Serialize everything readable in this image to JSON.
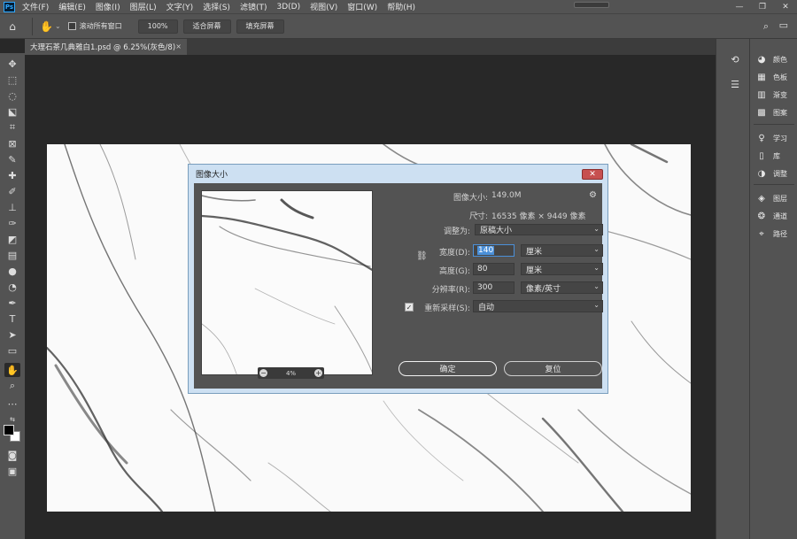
{
  "app": {
    "logo": "Ps",
    "menu": [
      "文件(F)",
      "编辑(E)",
      "图像(I)",
      "图层(L)",
      "文字(Y)",
      "选择(S)",
      "滤镜(T)",
      "3D(D)",
      "视图(V)",
      "窗口(W)",
      "帮助(H)"
    ],
    "window_controls": {
      "minimize": "—",
      "restore": "❐",
      "close": "✕"
    }
  },
  "options": {
    "scroll_all_label": "滚动所有窗口",
    "zoom_value": "100%",
    "fit_screen": "适合屏幕",
    "fill_screen": "填充屏幕"
  },
  "document": {
    "tab_title": "大理石茶几典雅白1.psd @ 6.25%(灰色/8)",
    "tab_close": "×"
  },
  "right_panels": [
    {
      "icon": "palette-icon",
      "label": "颜色"
    },
    {
      "icon": "swatches-icon",
      "label": "色板"
    },
    {
      "icon": "gradient-icon",
      "label": "渐变"
    },
    {
      "icon": "patterns-icon",
      "label": "图案"
    },
    {
      "icon": "lightbulb-icon",
      "label": "学习"
    },
    {
      "icon": "library-icon",
      "label": "库"
    },
    {
      "icon": "adjustments-icon",
      "label": "调整"
    },
    {
      "icon": "layers-icon",
      "label": "图层"
    },
    {
      "icon": "channels-icon",
      "label": "通道"
    },
    {
      "icon": "paths-icon",
      "label": "路径"
    }
  ],
  "dialog": {
    "title": "图像大小",
    "close": "✕",
    "image_size_label": "图像大小:",
    "image_size_value": "149.0M",
    "dimensions_label": "尺寸:",
    "dimensions_value": "16535 像素 × 9449 像素",
    "fit_to_label": "调整为:",
    "fit_to_value": "原稿大小",
    "width_label": "宽度(D):",
    "width_value": "140",
    "width_unit": "厘米",
    "height_label": "高度(G):",
    "height_value": "80",
    "height_unit": "厘米",
    "resolution_label": "分辨率(R):",
    "resolution_value": "300",
    "resolution_unit": "像素/英寸",
    "resample_label": "重新采样(S):",
    "resample_checked": true,
    "resample_value": "自动",
    "preview_zoom": "4%",
    "ok_button": "确定",
    "reset_button": "复位"
  }
}
